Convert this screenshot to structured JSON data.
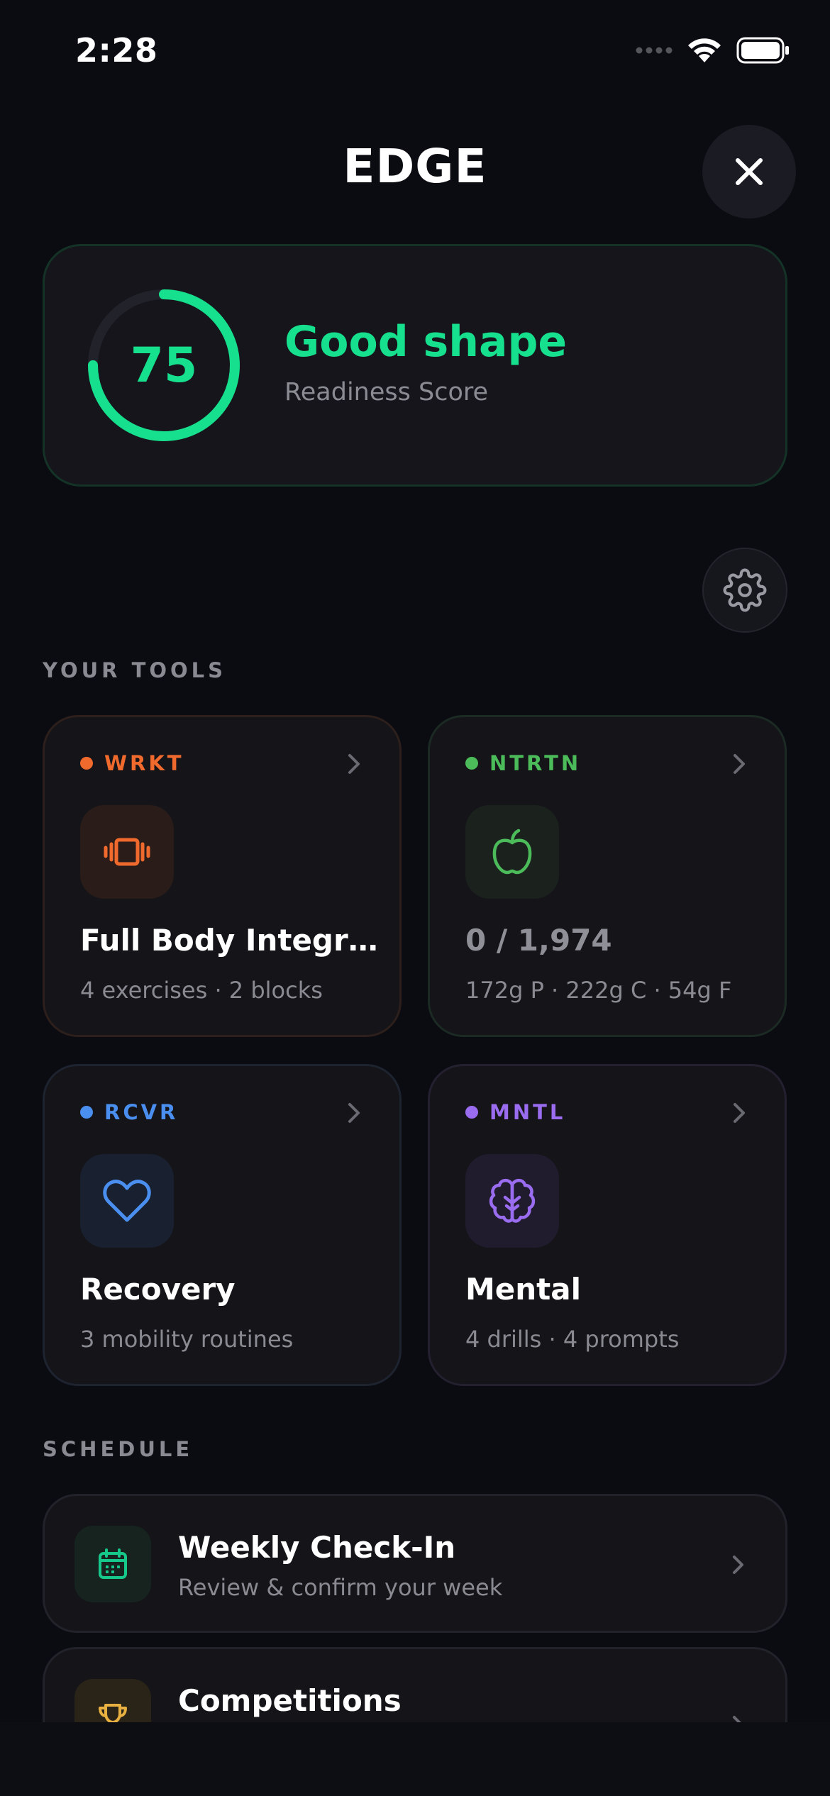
{
  "status": {
    "time": "2:28"
  },
  "header": {
    "title": "EDGE"
  },
  "readiness": {
    "score": "75",
    "score_fraction": 0.75,
    "status": "Good shape",
    "label": "Readiness Score"
  },
  "sections": {
    "tools": "YOUR TOOLS",
    "schedule": "SCHEDULE"
  },
  "tools": [
    {
      "tag": "WRKT",
      "title": "Full Body Integrati…",
      "subtitle": "4 exercises · 2 blocks",
      "color": "#f06a2e",
      "icon": "dumbbell-icon"
    },
    {
      "tag": "NTRTN",
      "title": "0 / 1,974",
      "subtitle": "172g P · 222g C · 54g F",
      "color": "#4cbb5a",
      "icon": "apple-icon"
    },
    {
      "tag": "RCVR",
      "title": "Recovery",
      "subtitle": "3 mobility routines",
      "color": "#4a8ff0",
      "icon": "heart-icon"
    },
    {
      "tag": "MNTL",
      "title": "Mental",
      "subtitle": "4 drills · 4 prompts",
      "color": "#9a6cf0",
      "icon": "brain-icon"
    }
  ],
  "schedule": [
    {
      "title": "Weekly Check-In",
      "subtitle": "Review & confirm your week",
      "icon": "calendar-icon",
      "color": "#16c88a"
    },
    {
      "title": "Competitions",
      "subtitle": "",
      "icon": "trophy-icon",
      "color": "#e8b040"
    }
  ],
  "colors": {
    "accent": "#16e08e",
    "background": "#0b0b12",
    "card": "#141419"
  }
}
